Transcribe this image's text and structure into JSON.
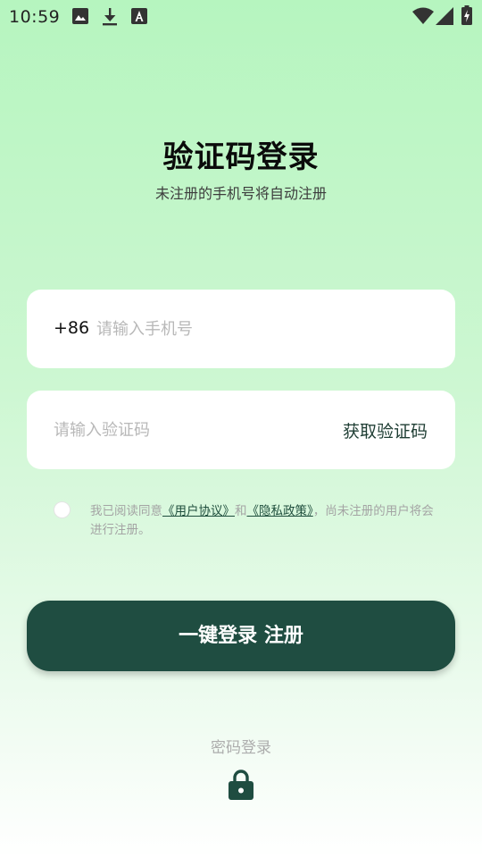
{
  "status_bar": {
    "time": "10:59",
    "icons": [
      "image-icon",
      "download-icon",
      "a-icon",
      "wifi-icon",
      "signal-icon",
      "battery-charging-icon"
    ]
  },
  "header": {
    "title": "验证码登录",
    "subtitle": "未注册的手机号将自动注册"
  },
  "phone": {
    "country_code": "+86",
    "placeholder": "请输入手机号",
    "value": ""
  },
  "code": {
    "placeholder": "请输入验证码",
    "value": "",
    "get_code_label": "获取验证码"
  },
  "agreement": {
    "checked": false,
    "prefix": "我已阅读同意",
    "user_agreement": "《用户协议》",
    "and": "和",
    "privacy_policy": "《隐私政策》",
    "suffix": "，尚未注册的用户将会进行注册。"
  },
  "login_button": {
    "label": "一键登录 注册"
  },
  "password_login": {
    "label": "密码登录",
    "icon": "lock-icon"
  },
  "colors": {
    "primary": "#1f4d41",
    "background_top": "#b6f5bf",
    "background_bottom": "#ffffff"
  }
}
